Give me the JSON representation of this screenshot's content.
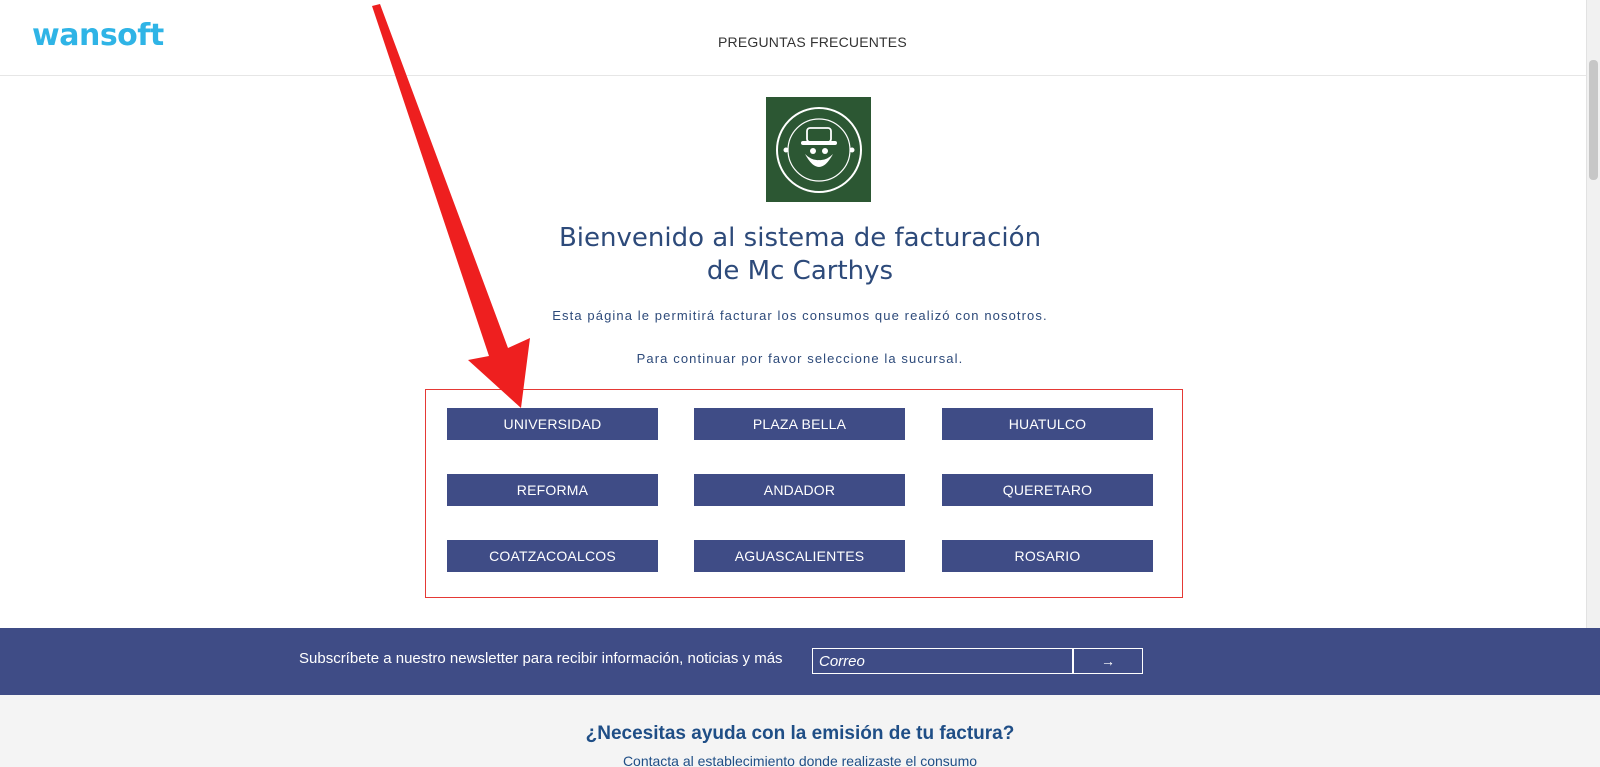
{
  "header": {
    "logo_text": "wansoft",
    "nav_faq": "PREGUNTAS FRECUENTES"
  },
  "welcome": {
    "line1": "Bienvenido al sistema de facturación",
    "line2": "de Mc Carthys",
    "desc1": "Esta página le permitirá facturar los consumos que realizó con nosotros.",
    "desc2": "Para continuar por favor seleccione la sucursal."
  },
  "branches": [
    "UNIVERSIDAD",
    "PLAZA BELLA",
    "HUATULCO",
    "REFORMA",
    "ANDADOR",
    "QUERETARO",
    "COATZACOALCOS",
    "AGUASCALIENTES",
    "ROSARIO"
  ],
  "newsletter": {
    "text": "Subscríbete a nuestro newsletter para recibir información, noticias y más",
    "input_placeholder": "Correo",
    "submit_icon": "arrow-right-icon",
    "submit_glyph": "→"
  },
  "help": {
    "title": "¿Necesitas ayuda con la emisión de tu factura?",
    "subtitle": "Contacta al establecimiento donde realizaste el consumo"
  },
  "colors": {
    "brand_blue": "#2fb4e6",
    "button_navy": "#3f4c86",
    "text_navy": "#2d4a7a",
    "annotation_red": "#e53935",
    "logo_green": "#2c5733"
  }
}
